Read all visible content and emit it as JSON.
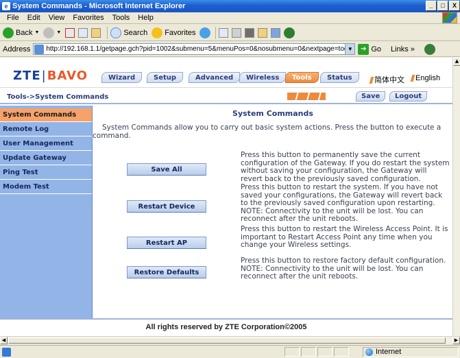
{
  "window": {
    "title": "System Commands - Microsoft Internet Explorer",
    "min": "_",
    "max": "□",
    "close": "X"
  },
  "menu": [
    "File",
    "Edit",
    "View",
    "Favorites",
    "Tools",
    "Help"
  ],
  "toolbar": {
    "back": "Back",
    "search": "Search",
    "favorites": "Favorites"
  },
  "address": {
    "label": "Address",
    "url": "http://192.168.1.1/getpage.gch?pid=1002&submenu=5&menuPos=0&nosubmenu=0&nextpage=tools/cor",
    "go": "Go",
    "links": "Links",
    "links_more": "»"
  },
  "router": {
    "logo_zte": "ZTE",
    "logo_bar": "|",
    "logo_bavo": "BAVO",
    "tabs": [
      "Wizard",
      "Setup",
      "Advanced",
      "Wireless",
      "Tools",
      "Status"
    ],
    "active_tab": "Tools",
    "lang_cn": "简体中文",
    "lang_en": "English",
    "breadcrumb": "Tools->System Commands",
    "save": "Save",
    "logout": "Logout",
    "sidebar": [
      "System Commands",
      "Remote Log",
      "User Management",
      "Update Gateway",
      "Ping Test",
      "Modem Test"
    ],
    "content_title": "System Commands",
    "intro": "System Commands allow you to carry out basic system actions. Press the button to execute a command.",
    "actions": [
      {
        "button": "Save All",
        "desc": "Press this button to permanently save the current configuration of the Gateway. If you do restart the system without saving your configuration, the Gateway will revert back to the previously saved configuration."
      },
      {
        "button": "Restart Device",
        "desc": "Press this button to restart the system. If you have not saved your configurations, the Gateway will revert back to the previously saved configuration upon restarting. NOTE: Connectivity to the unit will be lost. You can reconnect after the unit reboots."
      },
      {
        "button": "Restart AP",
        "desc": "Press this button to restart the Wireless Access Point. It is important to Restart Access Point any time when you change your Wireless settings."
      },
      {
        "button": "Restore Defaults",
        "desc": "Press this button to restore factory default configuration. NOTE: Connectivity to the unit will be lost. You can reconnect after the unit reboots."
      }
    ],
    "footer": "All rights reserved by ZTE Corporation©2005"
  },
  "status": {
    "zone": "Internet"
  },
  "colors": {
    "accent_orange": "#ee8a3c",
    "sidebar_blue": "#93b4e6",
    "brand_blue": "#1a3f94"
  }
}
